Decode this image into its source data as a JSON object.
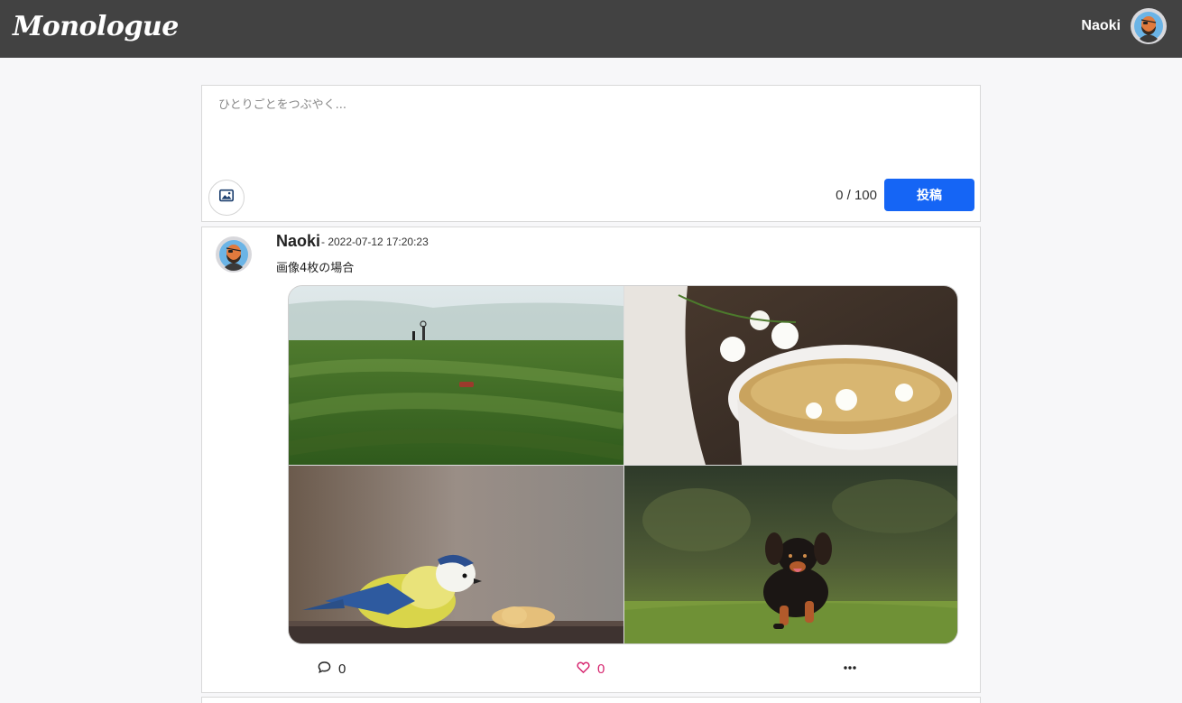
{
  "app": {
    "logo": "Monologue"
  },
  "header": {
    "user_name": "Naoki",
    "avatar_icon": "user-avatar-icon"
  },
  "composer": {
    "placeholder": "ひとりごとをつぶやく...",
    "value": "",
    "counter": "0 / 100",
    "post_label": "投稿",
    "image_icon": "image-icon",
    "accent": "#1565f5"
  },
  "post": {
    "author": "Naoki",
    "timestamp": "- 2022-07-12 17:20:23",
    "body": "画像4枚の場合",
    "images": [
      "green-hills-photo",
      "jasmine-tea-photo",
      "blue-tit-bird-photo",
      "running-puppy-photo"
    ],
    "comment_count": "0",
    "like_count": "0",
    "like_color": "#d6246e",
    "more_icon": "more-icon"
  }
}
